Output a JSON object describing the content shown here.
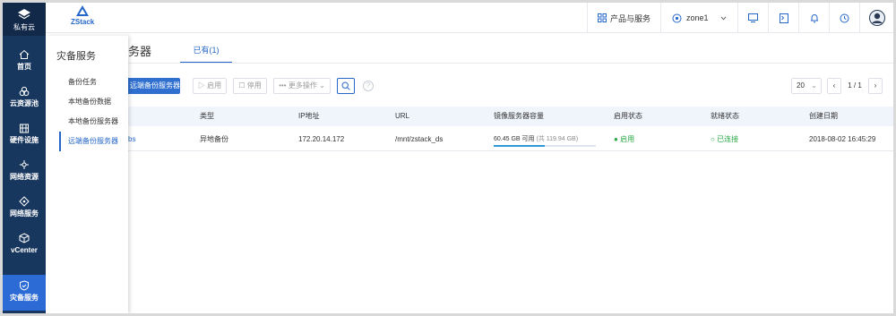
{
  "sidebar": {
    "brand": "私有云",
    "items": [
      {
        "label": "首页",
        "icon": "home-icon"
      },
      {
        "label": "云资源池",
        "icon": "cloud-pool-icon"
      },
      {
        "label": "硬件设施",
        "icon": "hardware-icon"
      },
      {
        "label": "网络资源",
        "icon": "network-resource-icon"
      },
      {
        "label": "网络服务",
        "icon": "network-service-icon"
      },
      {
        "label": "vCenter",
        "icon": "vcenter-icon"
      },
      {
        "label": "灾备服务",
        "icon": "disaster-recovery-icon"
      }
    ]
  },
  "topbar": {
    "logo": "ZStack",
    "products": "产品与服务",
    "zone": "zone1"
  },
  "panel": {
    "title": "灾备服务",
    "items": [
      "备份任务",
      "本地备份数据",
      "本地备份服务器",
      "远端备份服务器"
    ]
  },
  "main": {
    "title_partial": "务器",
    "tab": "已有(1)",
    "toolbar": {
      "add": "远端备份服务器",
      "enable": "启用",
      "disable": "停用",
      "more": "更多操作",
      "page_size": "20",
      "page": "1 / 1"
    },
    "columns": [
      "类型",
      "IP地址",
      "URL",
      "镜像服务器容量",
      "启用状态",
      "就绪状态",
      "创建日期"
    ],
    "rows": [
      {
        "name_partial": "bs",
        "type": "异地备份",
        "ip": "172.20.14.172",
        "url": "/mnt/zstack_ds",
        "capacity_available": "60.45 GB 可用",
        "capacity_total": "(共 119.94 GB)",
        "capacity_used_fraction": 0.5,
        "enable_state": "启用",
        "ready_state": "已连接",
        "created": "2018-08-02 16:45:29"
      }
    ]
  },
  "colors": {
    "accent": "#2567c8",
    "sidebar": "#18375e",
    "green": "#27a844"
  }
}
